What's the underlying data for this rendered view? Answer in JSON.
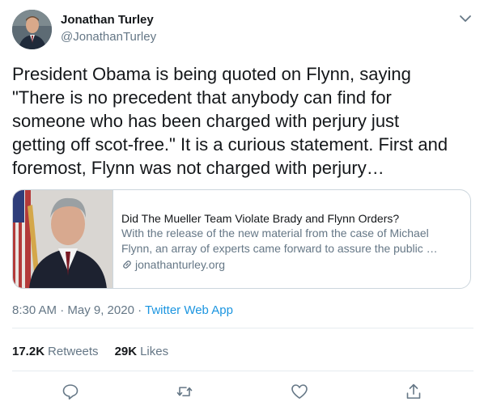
{
  "author": {
    "name": "Jonathan Turley",
    "handle": "@JonathanTurley"
  },
  "tweet": {
    "text": "President Obama is being quoted on Flynn, saying\n\"There is no precedent that anybody can find for\nsomeone who has been charged with perjury just\ngetting off scot-free.\" It is a curious statement. First and\nforemost, Flynn was not charged with perjury…"
  },
  "card": {
    "title": "Did The Mueller Team Violate Brady and Flynn Orders?",
    "description": "With the release of the new material from the case of Michael Flynn, an array of experts came forward to assure the public …",
    "domain": "jonathanturley.org"
  },
  "meta": {
    "timestamp": "8:30 AM · May 9, 2020",
    "separator": " · ",
    "source": "Twitter Web App"
  },
  "stats": {
    "retweets_count": "17.2K",
    "retweets_label": "Retweets",
    "likes_count": "29K",
    "likes_label": "Likes"
  },
  "icons": {
    "caret": "chevron-down-icon",
    "reply": "reply-icon",
    "retweet": "retweet-icon",
    "like": "heart-icon",
    "share": "share-icon",
    "link": "link-icon"
  },
  "colors": {
    "text": "#14171a",
    "secondary": "#657786",
    "link": "#1b95e0",
    "border": "#ccd6dd",
    "divider": "#e6ecf0"
  }
}
